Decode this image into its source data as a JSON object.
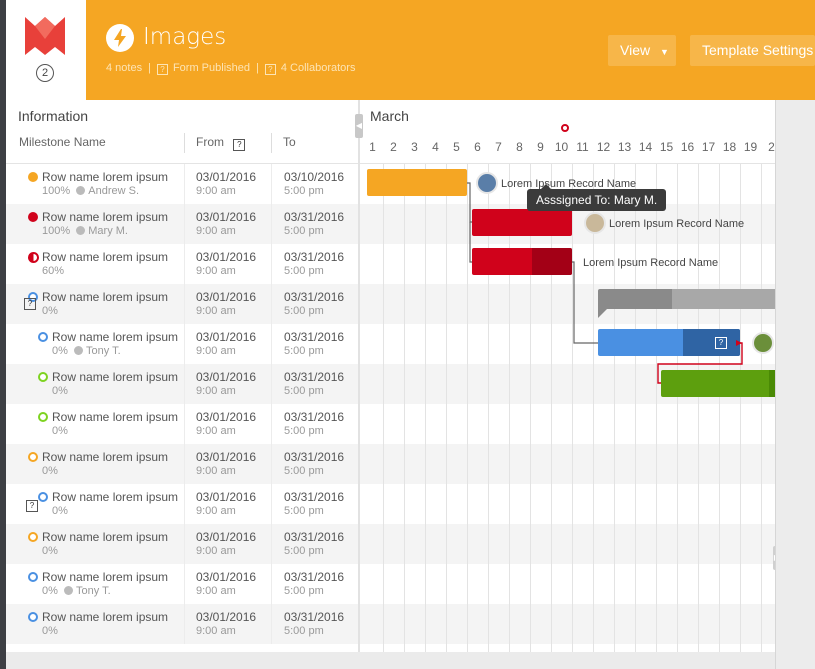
{
  "app": {
    "badge": "2",
    "title": "Images",
    "notes": "4 notes",
    "form_published": "Form Published",
    "collaborators": "4 Collaborators",
    "view_label": "View",
    "template_settings_label": "Template Settings"
  },
  "colors": {
    "header": "#f5a623",
    "yellow": "#f5a623",
    "red": "#d0021b",
    "blue": "#4a90e2",
    "green": "#5d9f0e",
    "gray": "#9b9b9b"
  },
  "grid": {
    "info_title": "Information",
    "col_milestone": "Milestone Name",
    "col_from": "From",
    "col_to": "To",
    "month": "March",
    "days": [
      "1",
      "2",
      "3",
      "4",
      "5",
      "6",
      "7",
      "8",
      "9",
      "10",
      "11",
      "12",
      "13",
      "14",
      "15",
      "16",
      "17",
      "18",
      "19",
      "2"
    ]
  },
  "rows": [
    {
      "name": "Row name lorem ipsum",
      "progress": "100%",
      "assignee": "Andrew S.",
      "from_date": "03/01/2016",
      "from_time": "9:00 am",
      "to_date": "03/10/2016",
      "to_time": "5:00 pm",
      "status": "yellow-filled"
    },
    {
      "name": "Row name lorem ipsum",
      "progress": "100%",
      "assignee": "Mary M.",
      "from_date": "03/01/2016",
      "from_time": "9:00 am",
      "to_date": "03/31/2016",
      "to_time": "5:00 pm",
      "status": "red-filled"
    },
    {
      "name": "Row name lorem ipsum",
      "progress": "60%",
      "assignee": "",
      "from_date": "03/01/2016",
      "from_time": "9:00 am",
      "to_date": "03/31/2016",
      "to_time": "5:00 pm",
      "status": "red-half"
    },
    {
      "name": "Row name lorem ipsum",
      "progress": "0%",
      "assignee": "",
      "from_date": "03/01/2016",
      "from_time": "9:00 am",
      "to_date": "03/31/2016",
      "to_time": "5:00 pm",
      "status": "blue-ring"
    },
    {
      "name": "Row name lorem ipsum",
      "progress": "0%",
      "assignee": "Tony T.",
      "from_date": "03/01/2016",
      "from_time": "9:00 am",
      "to_date": "03/31/2016",
      "to_time": "5:00 pm",
      "status": "blue-ring"
    },
    {
      "name": "Row name lorem ipsum",
      "progress": "0%",
      "assignee": "",
      "from_date": "03/01/2016",
      "from_time": "9:00 am",
      "to_date": "03/31/2016",
      "to_time": "5:00 pm",
      "status": "green-ring"
    },
    {
      "name": "Row name lorem ipsum",
      "progress": "0%",
      "assignee": "",
      "from_date": "03/01/2016",
      "from_time": "9:00 am",
      "to_date": "03/31/2016",
      "to_time": "5:00 pm",
      "status": "green-ring"
    },
    {
      "name": "Row name lorem ipsum",
      "progress": "0%",
      "assignee": "",
      "from_date": "03/01/2016",
      "from_time": "9:00 am",
      "to_date": "03/31/2016",
      "to_time": "5:00 pm",
      "status": "yellow-ring"
    },
    {
      "name": "Row name lorem ipsum",
      "progress": "0%",
      "assignee": "",
      "from_date": "03/01/2016",
      "from_time": "9:00 am",
      "to_date": "03/31/2016",
      "to_time": "5:00 pm",
      "status": "blue-ring"
    },
    {
      "name": "Row name lorem ipsum",
      "progress": "0%",
      "assignee": "",
      "from_date": "03/01/2016",
      "from_time": "9:00 am",
      "to_date": "03/31/2016",
      "to_time": "5:00 pm",
      "status": "yellow-ring"
    },
    {
      "name": "Row name lorem ipsum",
      "progress": "0%",
      "assignee": "Tony T.",
      "from_date": "03/01/2016",
      "from_time": "9:00 am",
      "to_date": "03/31/2016",
      "to_time": "5:00 pm",
      "status": "blue-ring"
    },
    {
      "name": "Row name lorem ipsum",
      "progress": "0%",
      "assignee": "",
      "from_date": "03/01/2016",
      "from_time": "9:00 am",
      "to_date": "03/31/2016",
      "to_time": "5:00 pm",
      "status": "blue-ring"
    }
  ],
  "gantt": {
    "record_label": "Lorem Ipsum Record Name",
    "tooltip": "Asssigned To: Mary M."
  },
  "icons": {
    "logo": "brand-logo-icon",
    "bolt": "lightning-bolt-icon",
    "question": "question-box-icon",
    "dropdown": "caret-down-icon"
  }
}
